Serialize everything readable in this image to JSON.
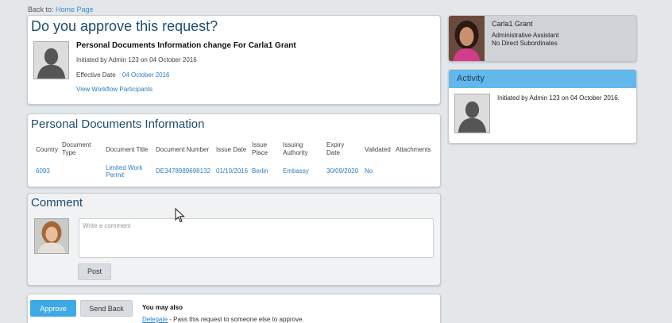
{
  "back": {
    "prefix": "Back to:",
    "link": "Home Page"
  },
  "approve": {
    "title": "Do you approve this request?",
    "request_title": "Personal Documents Information change For Carla1 Grant",
    "initiated": "Initiated by Admin 123 on 04 October 2016",
    "effective_label": "Effective Date",
    "effective_value": "04 October 2016",
    "workflow_link": "View Workflow Participants"
  },
  "documents": {
    "title": "Personal Documents Information",
    "headers": {
      "country": "Country",
      "doc_type_1": "Document",
      "doc_type_2": "Type",
      "doc_title": "Document Title",
      "doc_number": "Document Number",
      "issue_date": "Issue Date",
      "issue_place_1": "Issue",
      "issue_place_2": "Place",
      "authority_1": "Issuing",
      "authority_2": "Authority",
      "expiry_1": "Expiry",
      "expiry_2": "Date",
      "validated": "Validated",
      "attachments": "Attachments"
    },
    "row": {
      "country": "6093",
      "doc_type": "",
      "doc_title_1": "Limited Work",
      "doc_title_2": "Permit",
      "doc_number": "DE3478989698132",
      "issue_date": "01/10/2016",
      "issue_place": "Berlin",
      "authority": "Embassy",
      "expiry": "30/09/2020",
      "validated": "No",
      "attachments": ""
    }
  },
  "comment": {
    "title": "Comment",
    "placeholder": "Write a comment",
    "post_label": "Post"
  },
  "actions": {
    "approve_label": "Approve",
    "send_back_label": "Send Back",
    "also_label": "You may also",
    "delegate_link": "Delegate",
    "delegate_text": " - Pass this request to someone else to approve."
  },
  "profile": {
    "name": "Carla1 Grant",
    "role": "Administrative Assistant",
    "subordinates": "No Direct Subordinates"
  },
  "activity": {
    "title": "Activity",
    "entry": "Initiated by Admin 123 on 04 October 2016."
  },
  "colors": {
    "accent": "#3fa9e6",
    "activity_bar": "#62b8eb",
    "link": "#2a7fc0",
    "heading": "#1f4b6e"
  }
}
